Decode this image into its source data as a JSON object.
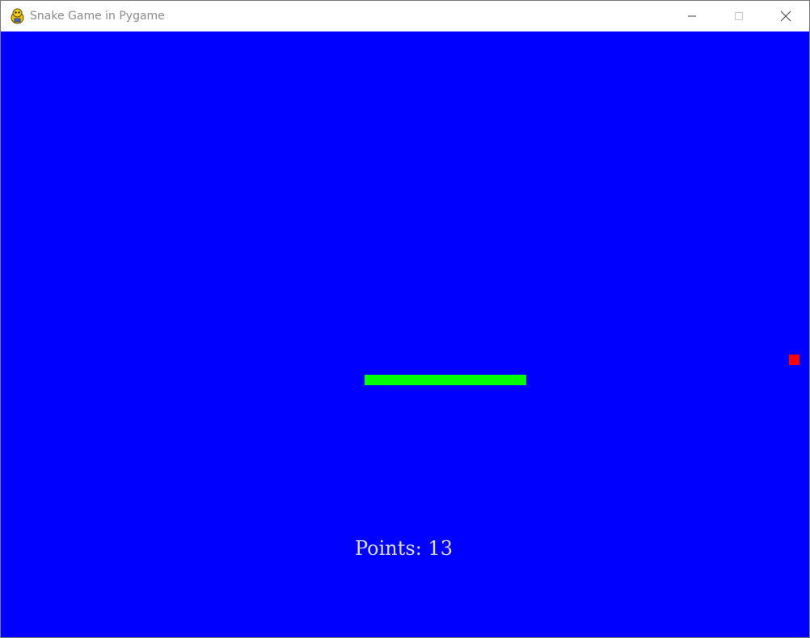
{
  "window": {
    "title": "Snake Game in Pygame",
    "icon": "pygame-snake-icon",
    "controls": [
      "minimize-icon",
      "maximize-icon",
      "close-icon"
    ]
  },
  "game": {
    "background_color": "#0000ff",
    "snake_color": "#00ff00",
    "food_color": "#ff0000",
    "score_text": "Points: 13"
  }
}
